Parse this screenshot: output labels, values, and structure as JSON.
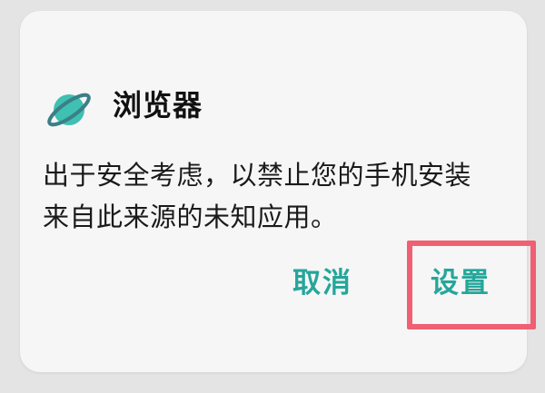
{
  "dialog": {
    "app_icon": "planet-browser-icon",
    "app_name": "浏览器",
    "message_line1": "出于安全考虑，以禁止您的手机安装",
    "message_line2": "来自此来源的未知应用。",
    "cancel_label": "取消",
    "settings_label": "设置"
  },
  "colors": {
    "accent": "#26a69a",
    "icon_teal": "#3fc0b2",
    "highlight": "#f06072"
  }
}
